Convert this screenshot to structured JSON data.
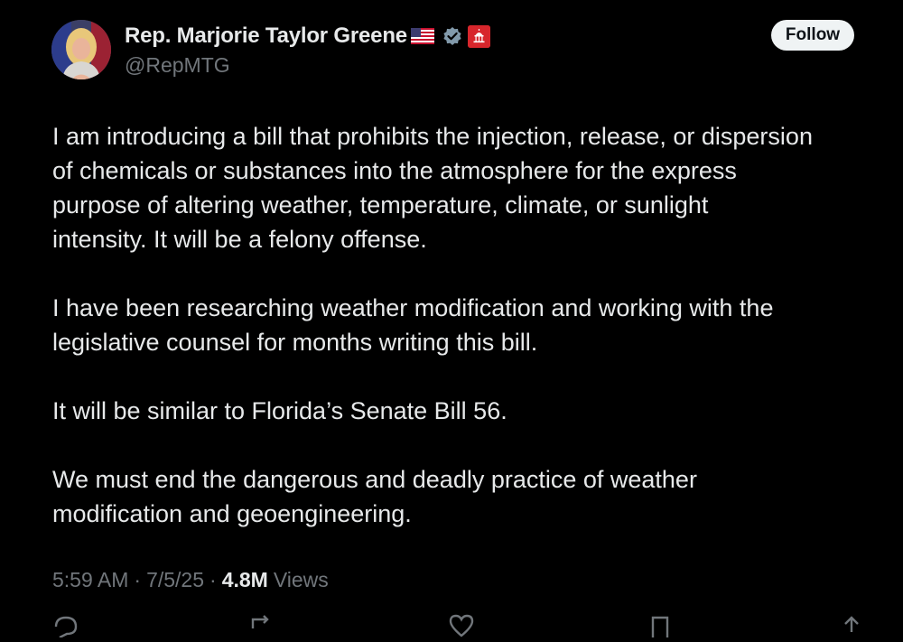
{
  "author": {
    "name": "Rep. Marjorie Taylor Greene",
    "handle": "@RepMTG",
    "avatar_icon": "profile-photo",
    "flag_icon": "us-flag-icon",
    "verified_icon": "verified-badge-icon",
    "affiliation_icon": "capitol-badge-icon"
  },
  "follow_label": "Follow",
  "tweet": {
    "paragraphs": [
      "I am introducing a bill that prohibits the injection, release, or dispersion\nof chemicals or substances into the atmosphere for the express\npurpose of altering weather, temperature, climate, or sunlight\nintensity. It will be a felony offense.",
      "I have been researching weather modification and working with the\nlegislative counsel for months writing this bill.",
      "It will be similar to Florida’s Senate Bill 56.",
      "We must end the dangerous and deadly practice of weather\nmodification and geoengineering."
    ]
  },
  "meta": {
    "time": "5:59 AM",
    "date": "7/5/25",
    "views_count": "4.8M",
    "views_label": "Views",
    "separator": "·"
  },
  "colors": {
    "background": "#000000",
    "text": "#e7e9ea",
    "secondary": "#71767b",
    "verified": "#829aab",
    "affiliation": "#d7262c"
  }
}
